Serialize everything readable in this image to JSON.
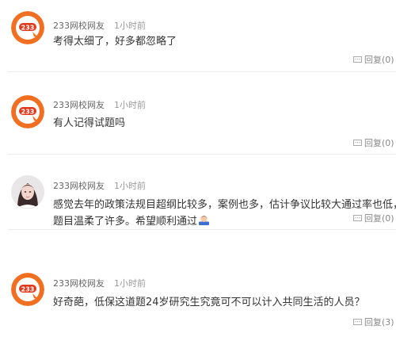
{
  "comments": [
    {
      "avatar": "233-logo-avatar",
      "username": "233网校网友",
      "time": "1小时前",
      "text": "考得太细了，好多都忽略了",
      "reply_label": "回复(0)"
    },
    {
      "avatar": "233-logo-avatar",
      "username": "233网校网友",
      "time": "1小时前",
      "text": "有人记得试题吗",
      "reply_label": "回复(0)"
    },
    {
      "avatar": "user-photo-avatar",
      "username": "233网校网友",
      "time": "1小时前",
      "text_line1": "感觉去年的政策法规目超纲比较多，案例也多，估计争议比较大通过率也低，",
      "text_line2": "题目温柔了许多。希望顺利通过",
      "emoji": "praying-emoji",
      "reply_label": "回复(0)"
    },
    {
      "avatar": "233-logo-avatar",
      "username": "233网校网友",
      "time": "1小时前",
      "text": "好奇葩，低保这道题24岁研究生究竟可不可以计入共同生活的人员？",
      "reply_label": "回复(3)"
    }
  ],
  "colors": {
    "logo_orange": "#f26f21",
    "logo_red": "#e03a1e",
    "text": "#333333",
    "muted": "#999999"
  }
}
